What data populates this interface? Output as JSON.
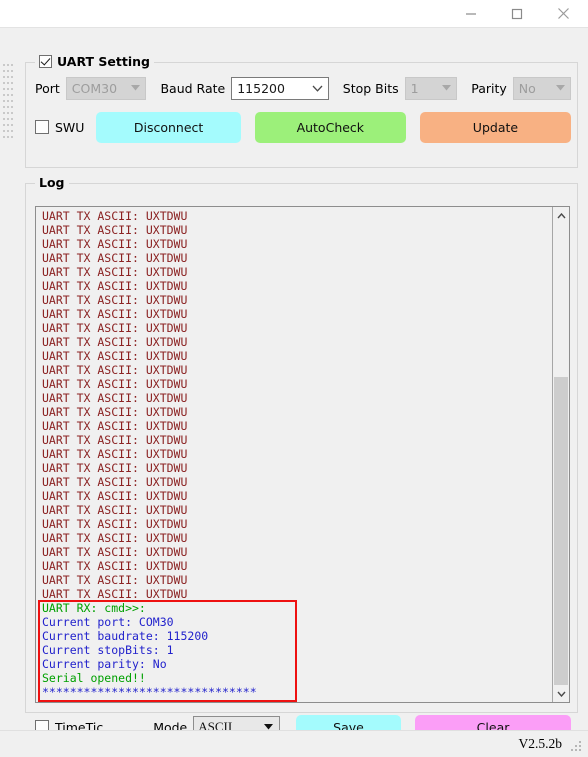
{
  "window": {
    "minimize_label": "Minimize",
    "maximize_label": "Maximize",
    "close_label": "Close"
  },
  "uart_setting": {
    "group_title": "UART Setting",
    "group_checked": true,
    "port_label": "Port",
    "port_value": "COM30",
    "port_enabled": false,
    "baud_label": "Baud Rate",
    "baud_value": "115200",
    "stop_label": "Stop Bits",
    "stop_value": "1",
    "stop_enabled": false,
    "parity_label": "Parity",
    "parity_value": "No",
    "parity_enabled": false,
    "swu_label": "SWU",
    "swu_checked": false,
    "disconnect_label": "Disconnect",
    "autocheck_label": "AutoCheck",
    "update_label": "Update",
    "colors": {
      "disconnect": "#a4fbfd",
      "autocheck": "#9cf07a",
      "update": "#f8b183"
    }
  },
  "log": {
    "group_title": "Log",
    "tx_line": "UART TX ASCII: UXTDWU",
    "tx_repeat_count": 28,
    "tx_color": "#8b2222",
    "rx_color": "#00a000",
    "info_color": "#2222cc",
    "highlight_color": "#ee1111",
    "rx_block": [
      {
        "text": "UART RX: cmd>>:",
        "style": "rx"
      },
      {
        "text": "Current port: COM30",
        "style": "info"
      },
      {
        "text": "Current baudrate: 115200",
        "style": "info"
      },
      {
        "text": "Current stopBits: 1",
        "style": "info"
      },
      {
        "text": "Current parity: No",
        "style": "info"
      },
      {
        "text": "Serial opened!!",
        "style": "rx"
      },
      {
        "text": "*******************************",
        "style": "info"
      }
    ]
  },
  "bottom": {
    "timetic_label": "TimeTic",
    "timetic_checked": false,
    "mode_label": "Mode",
    "mode_value": "ASCII",
    "save_label": "Save",
    "clear_label": "Clear",
    "colors": {
      "save": "#a4fbfd",
      "clear": "#fb9ef7"
    }
  },
  "status": {
    "version": "V2.5.2b"
  }
}
